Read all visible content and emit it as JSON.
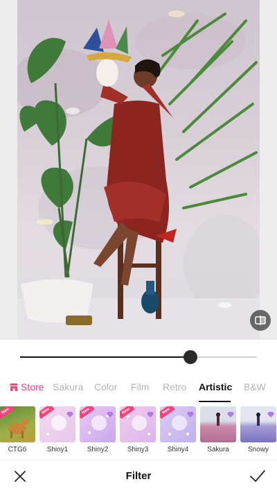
{
  "editor": {
    "intensity": 0.72
  },
  "tabs": [
    {
      "label": "Store",
      "active": false
    },
    {
      "label": "Sakura",
      "active": false
    },
    {
      "label": "Color",
      "active": false
    },
    {
      "label": "Film",
      "active": false
    },
    {
      "label": "Retro",
      "active": false
    },
    {
      "label": "Artistic",
      "active": true
    },
    {
      "label": "B&W",
      "active": false
    }
  ],
  "filters": [
    {
      "label": "CTG6",
      "badge": "New",
      "premium": false
    },
    {
      "label": "Shiny1",
      "badge": "New",
      "premium": true
    },
    {
      "label": "Shiny2",
      "badge": "New",
      "premium": true
    },
    {
      "label": "Shiny3",
      "badge": "New",
      "premium": true
    },
    {
      "label": "Shiny4",
      "badge": "New",
      "premium": true
    },
    {
      "label": "Sakura",
      "badge": "",
      "premium": true
    },
    {
      "label": "Snowy",
      "badge": "",
      "premium": true
    }
  ],
  "bottom_bar": {
    "title": "Filter"
  },
  "colors": {
    "accent": "#ff3d7a",
    "active_text": "#111111",
    "inactive_text": "#b4b4b4"
  },
  "icons": {
    "store": "store-icon",
    "compare": "compare-icon",
    "close": "close-icon",
    "confirm": "checkmark-icon",
    "premium": "diamond-icon"
  }
}
